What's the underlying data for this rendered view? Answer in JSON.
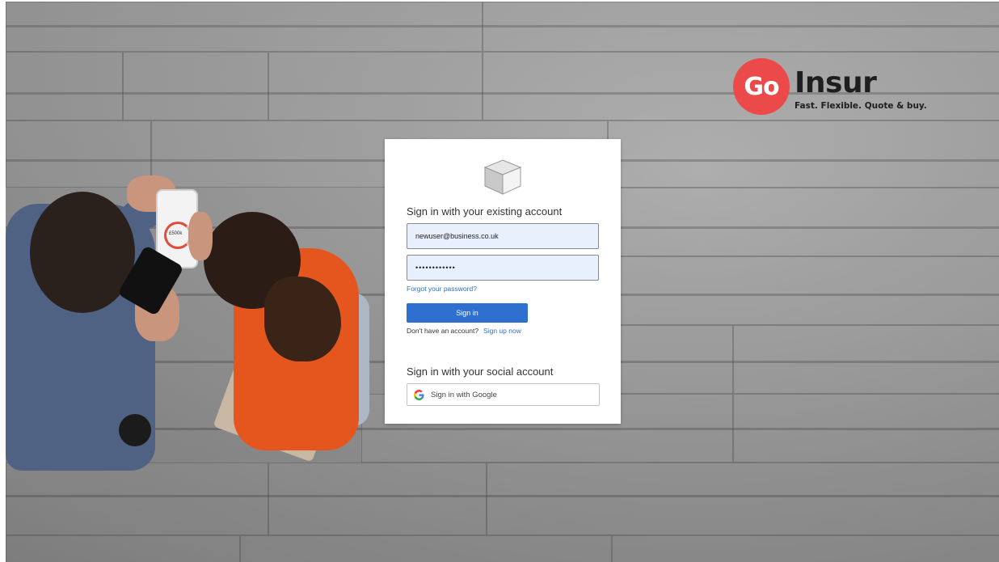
{
  "logo": {
    "mark_text": "Go",
    "word": "Insur",
    "tagline": "Fast. Flexible. Quote & buy.",
    "mark_color": "#ec4a4a"
  },
  "signin": {
    "heading": "Sign in with your existing account",
    "email_value": "newuser@business.co.uk",
    "password_value": "••••••••••••",
    "forgot_link": "Forgot your password?",
    "signin_button": "Sign in",
    "no_account_text": "Don't have an account?",
    "signup_link": "Sign up now",
    "accent_color": "#2e6fcf"
  },
  "social": {
    "heading": "Sign in with your social account",
    "google_button": "Sign in with Google",
    "google_icon": "google-g-icon"
  },
  "illustration": {
    "phone_screen_text": "£500k"
  }
}
